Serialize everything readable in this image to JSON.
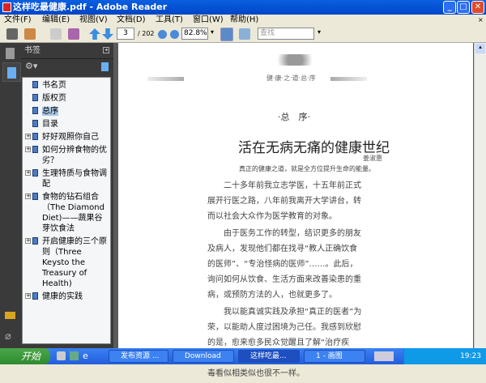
{
  "window": {
    "title": "这样吃最健康.pdf - Adobe Reader"
  },
  "menu": [
    "文件(F)",
    "编辑(E)",
    "视图(V)",
    "文档(D)",
    "工具(T)",
    "窗口(W)",
    "帮助(H)"
  ],
  "toolbar": {
    "page": "3",
    "page_total": "/ 202",
    "zoom": "82.8%",
    "find_placeholder": "查找"
  },
  "bookmarks": {
    "title": "书签",
    "items": [
      {
        "label": "书名页",
        "expandable": false
      },
      {
        "label": "版权页",
        "expandable": false
      },
      {
        "label": "总序",
        "expandable": false,
        "selected": true
      },
      {
        "label": "目录",
        "expandable": false
      },
      {
        "label": "好好观照你自己",
        "expandable": true
      },
      {
        "label": "如何分辨食物的优劣？",
        "expandable": true
      },
      {
        "label": "生理特质与食物调配",
        "expandable": true
      },
      {
        "label": "食物的钻石组合（The Diamond Diet)——蔬果谷芽饮食法",
        "expandable": true
      },
      {
        "label": "开启健康的三个原则（Three Keysto the Treasury of Health)",
        "expandable": true
      },
      {
        "label": "健康的实践",
        "expandable": true
      }
    ]
  },
  "document": {
    "header": "健·康·之·道·总·序",
    "section": "·总　序·",
    "title": "活在无病无痛的健康世纪",
    "author": "姜淑惠",
    "subtitle": "真正的健康之道，就是全方位提升生命的能量。",
    "paragraphs": [
      "二十多年前我立志学医，十五年前正式展开行医之路，八年前我离开大学讲台，转而以社会大众作为医学教育的对象。",
      "由于医务工作的转型，结识更多的朋友及病人，发现他们都在找寻“教人正确饮食的医师”、“专治怪病的医师”……。此后，询问如何从饮食、生活方面来改善染患的重病，或预防方法的人，也就更多了。",
      "我以能真诚实践及承担“真正的医者”为荣，以能助人度过困境为己任。我感到欣慰的是，愈来愈多民众觉醒且了解“治疗疾病”与“痊愈健康”是截然不同的；生病与排毒看似相类似也很不一样。"
    ]
  },
  "taskbar": {
    "start": "开始",
    "tasks": [
      "发布资源 ...",
      "Download",
      "这样吃最...",
      "1 - 画图"
    ],
    "clock": "19:23"
  }
}
